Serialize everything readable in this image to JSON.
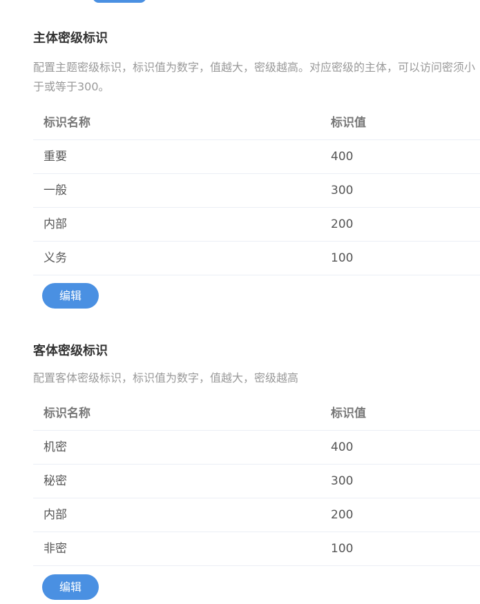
{
  "subject_section": {
    "title": "主体密级标识",
    "description": "配置主题密级标识，标识值为数字，值越大，密级越高。对应密级的主体，可以访问密须小于或等于300。",
    "columns": {
      "name": "标识名称",
      "value": "标识值"
    },
    "rows": [
      {
        "name": "重要",
        "value": "400"
      },
      {
        "name": "一般",
        "value": "300"
      },
      {
        "name": "内部",
        "value": "200"
      },
      {
        "name": "义务",
        "value": "100"
      }
    ],
    "edit_label": "编辑"
  },
  "object_section": {
    "title": "客体密级标识",
    "description": "配置客体密级标识，标识值为数字，值越大，密级越高",
    "columns": {
      "name": "标识名称",
      "value": "标识值"
    },
    "rows": [
      {
        "name": "机密",
        "value": "400"
      },
      {
        "name": "秘密",
        "value": "300"
      },
      {
        "name": "内部",
        "value": "200"
      },
      {
        "name": "非密",
        "value": "100"
      }
    ],
    "edit_label": "编辑"
  },
  "colors": {
    "accent": "#4a90e2",
    "title_text": "#333333",
    "desc_text": "#999999",
    "divider": "#ebeef5"
  }
}
